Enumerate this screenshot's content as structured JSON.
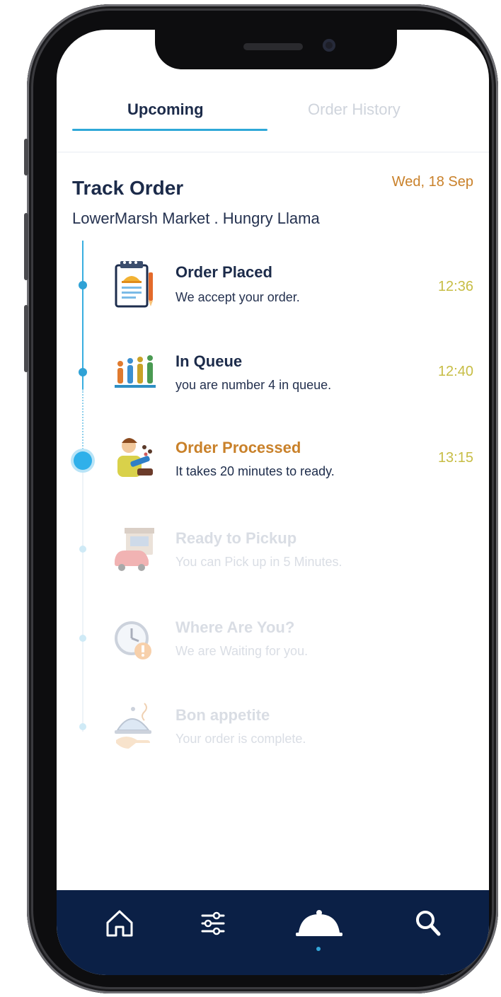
{
  "tabs": [
    {
      "label": "Upcoming",
      "active": true
    },
    {
      "label": "Order History",
      "active": false
    }
  ],
  "header": {
    "title": "Track Order",
    "date": "Wed, 18 Sep",
    "subtitle": "LowerMarsh Market . Hungry Llama"
  },
  "steps": [
    {
      "title": "Order Placed",
      "description": "We accept your order.",
      "time": "12:36",
      "status": "done",
      "icon": "order-notepad-icon"
    },
    {
      "title": "In Queue",
      "description": "you are number 4 in queue.",
      "time": "12:40",
      "status": "done",
      "icon": "queue-people-icon"
    },
    {
      "title": "Order Processed",
      "description": "It takes 20 minutes to ready.",
      "time": "13:15",
      "status": "current",
      "icon": "chef-cooking-icon"
    },
    {
      "title": "Ready to Pickup",
      "description": "You can Pick up in 5 Minutes.",
      "time": "",
      "status": "pending",
      "icon": "car-store-icon"
    },
    {
      "title": "Where Are You?",
      "description": "We are Waiting for you.",
      "time": "",
      "status": "pending",
      "icon": "clock-icon"
    },
    {
      "title": "Bon appetite",
      "description": "Your order is complete.",
      "time": "",
      "status": "pending",
      "icon": "food-cloche-icon"
    }
  ],
  "nav": [
    {
      "icon": "home-icon",
      "active": false
    },
    {
      "icon": "filter-sliders-icon",
      "active": false
    },
    {
      "icon": "cloche-icon",
      "active": true
    },
    {
      "icon": "search-icon",
      "active": false
    }
  ],
  "colors": {
    "primary": "#1c2b4a",
    "accent": "#2fa8d8",
    "current_step": "#c9812a",
    "time": "#c7bd45",
    "pending": "#c5cdd9",
    "nav_bg": "#0b2046"
  }
}
